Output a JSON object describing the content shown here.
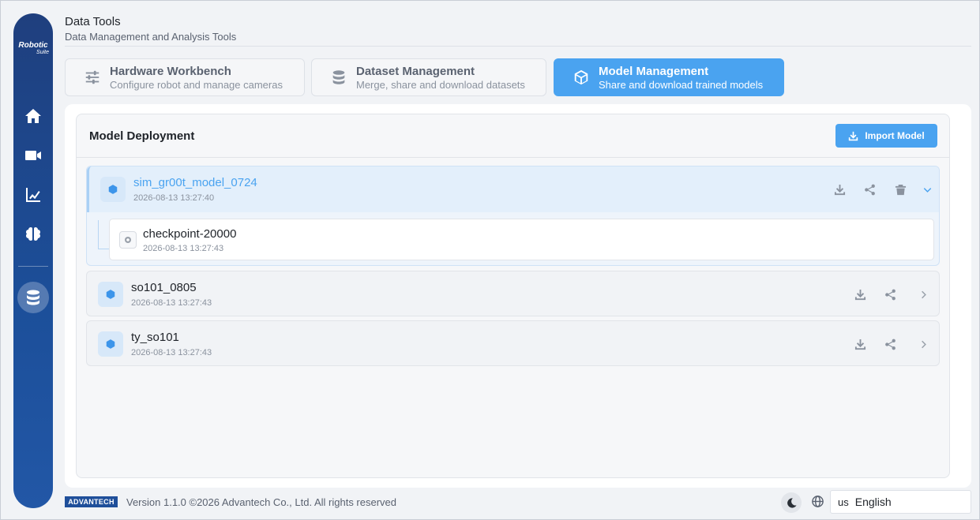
{
  "header": {
    "title": "Data Tools",
    "subtitle": "Data Management and Analysis Tools"
  },
  "sidebar": {
    "logo_line1": "Robotic",
    "logo_line2": "Suite",
    "items": [
      {
        "name": "home",
        "icon": "home-icon"
      },
      {
        "name": "camera",
        "icon": "video-camera-icon"
      },
      {
        "name": "analytics",
        "icon": "line-chart-icon"
      },
      {
        "name": "ai",
        "icon": "brain-icon"
      },
      {
        "name": "data-tools",
        "icon": "database-icon",
        "active": true
      }
    ]
  },
  "tabs": [
    {
      "label": "Hardware Workbench",
      "sub": "Configure robot and manage cameras",
      "icon": "sliders-icon"
    },
    {
      "label": "Dataset Management",
      "sub": "Merge, share and download datasets",
      "icon": "database-icon"
    },
    {
      "label": "Model Management",
      "sub": "Share and download trained models",
      "icon": "cube-icon",
      "active": true
    }
  ],
  "panel": {
    "title": "Model Deployment",
    "import_label": "Import Model"
  },
  "models": [
    {
      "name": "sim_gr00t_model_0724",
      "date": "2026-08-13 13:27:40",
      "expanded": true,
      "checkpoints": [
        {
          "name": "checkpoint-20000",
          "date": "2026-08-13 13:27:43"
        }
      ]
    },
    {
      "name": "so101_0805",
      "date": "2026-08-13 13:27:43",
      "expanded": false
    },
    {
      "name": "ty_so101",
      "date": "2026-08-13 13:27:43",
      "expanded": false
    }
  ],
  "footer": {
    "brand": "ADVANTECH",
    "version_text": "Version 1.1.0 ©2026 Advantech Co., Ltd. All rights reserved",
    "language_code": "us",
    "language": "English"
  },
  "colors": {
    "accent": "#4aa3f0",
    "sidebar": "#1f4f9a"
  }
}
